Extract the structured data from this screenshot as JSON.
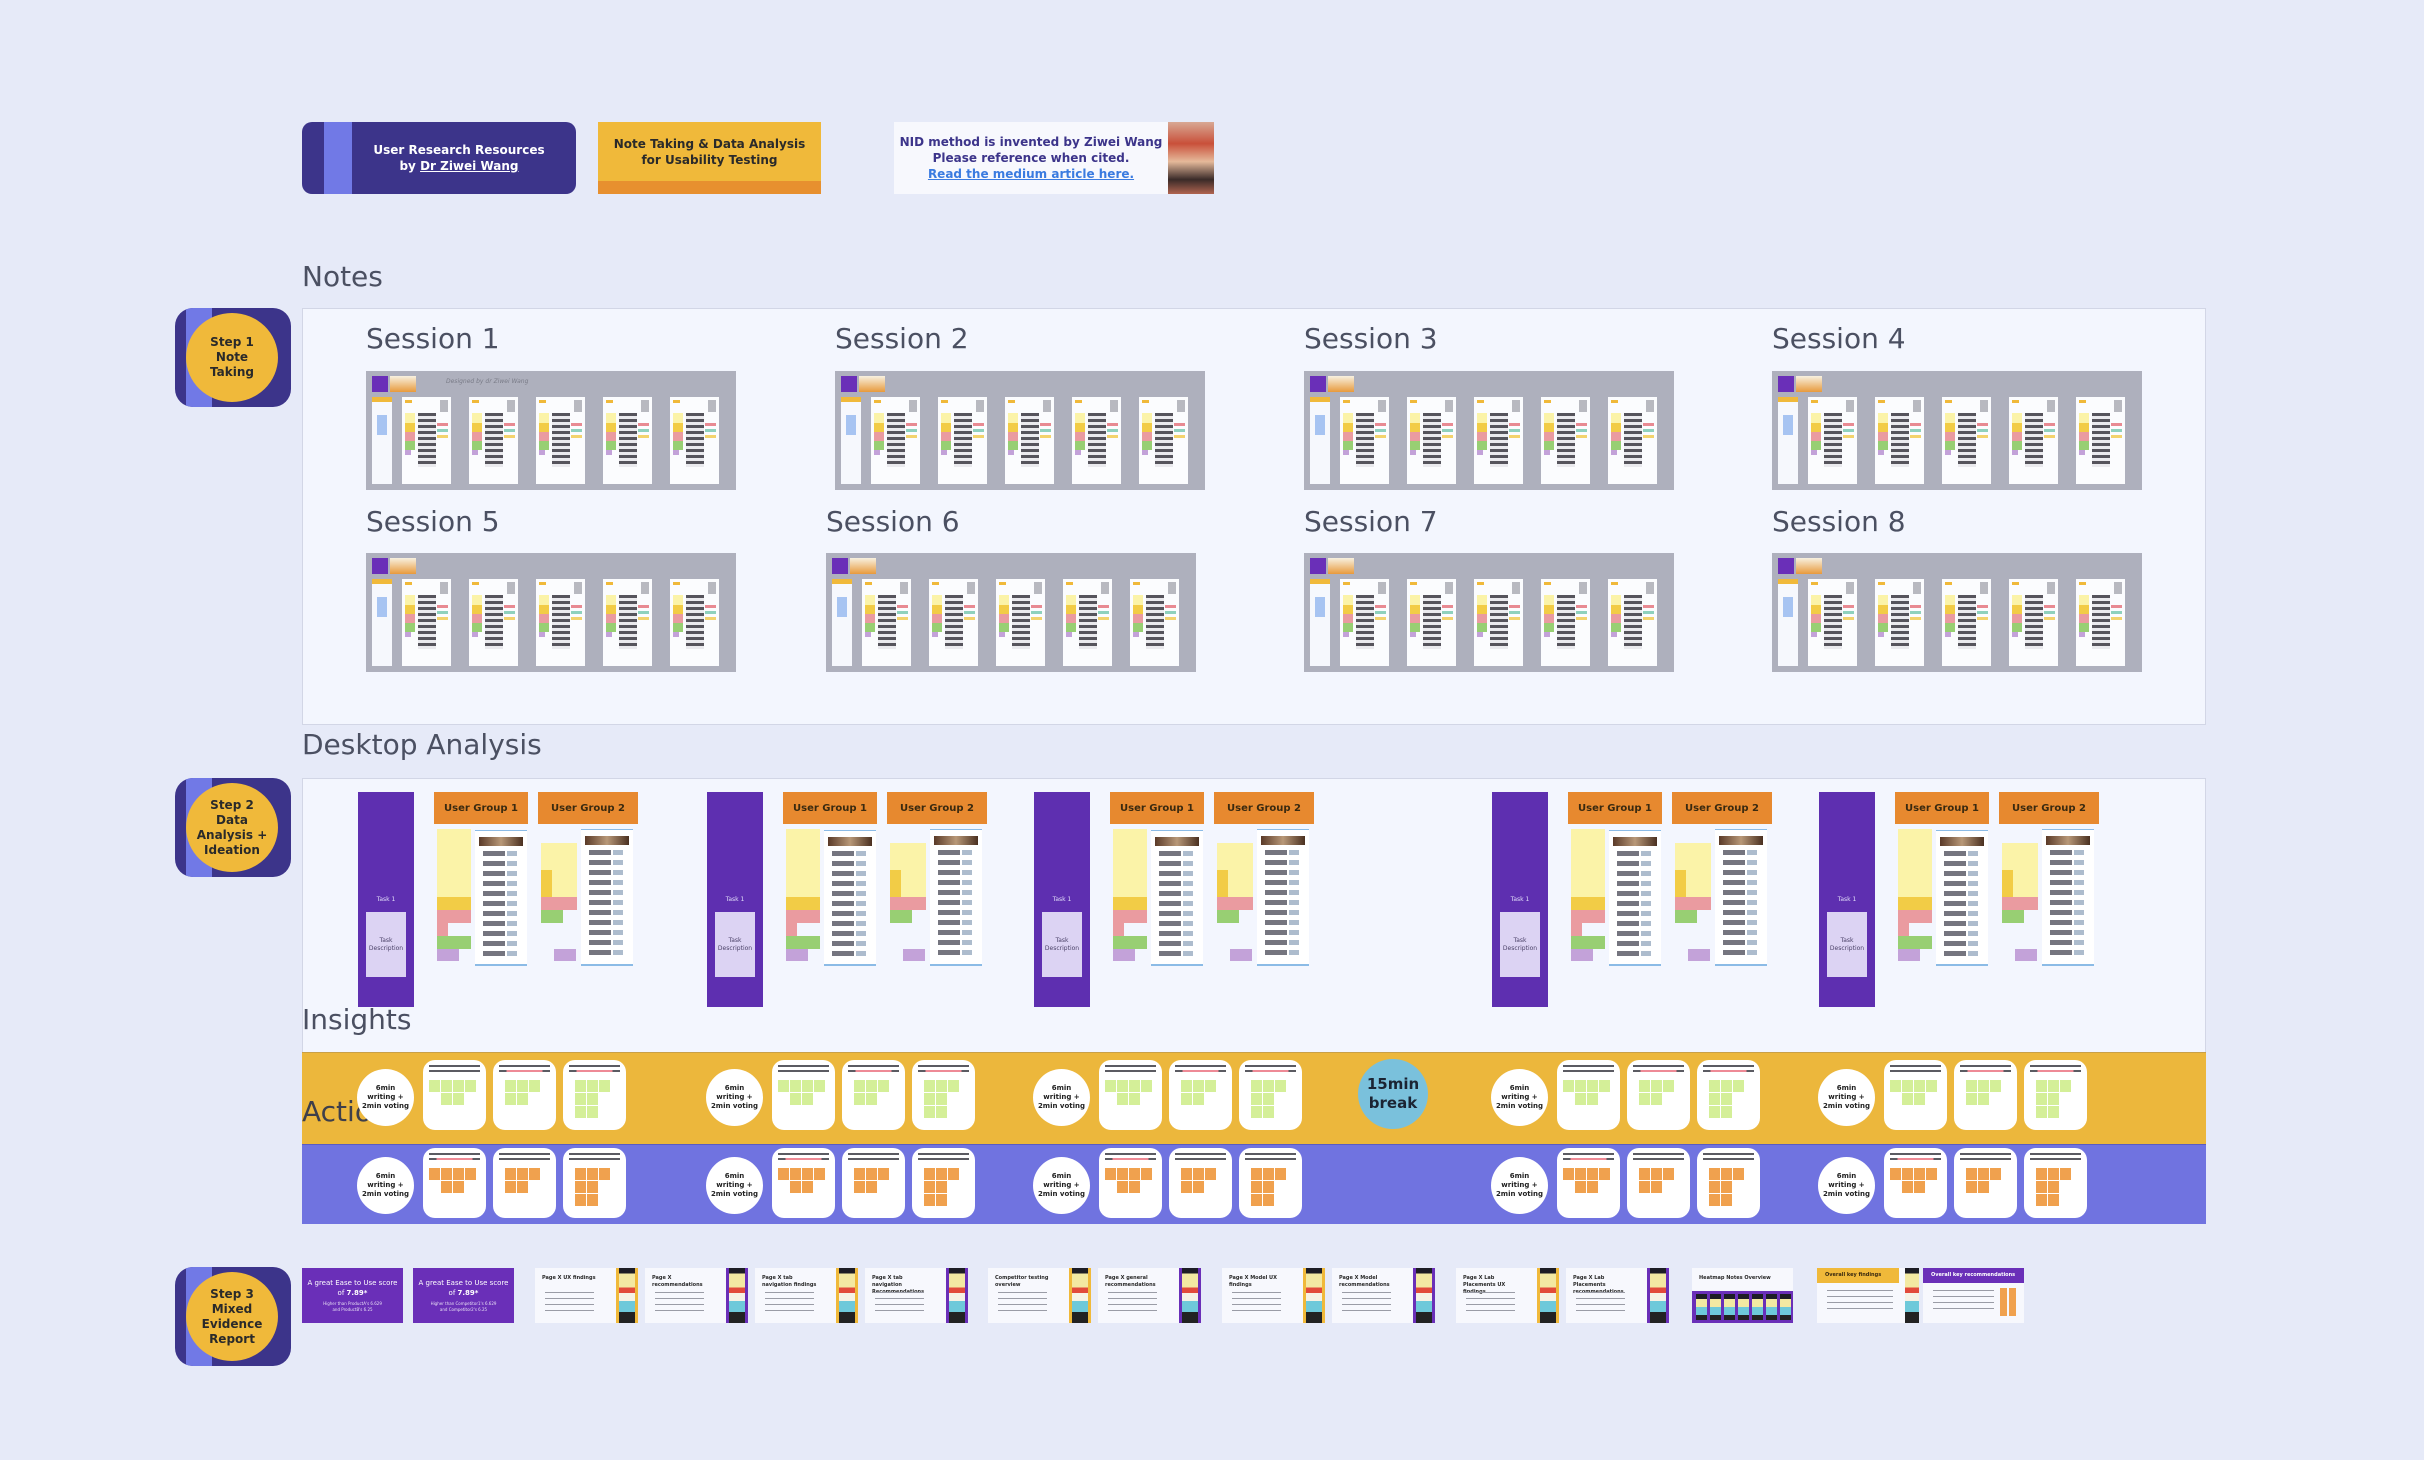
{
  "header": {
    "resources_button": {
      "line1": "User Research Resources",
      "line2_prefix": "by ",
      "author_link": "Dr Ziwei Wang"
    },
    "topic_button": {
      "line1": "Note Taking & Data Analysis",
      "line2": "for Usability Testing"
    },
    "citation_card": {
      "line1": "NID method is invented by Ziwei Wang",
      "line2": "Please reference when cited.",
      "link": "Read the medium article here."
    }
  },
  "colors": {
    "background": "#e6eaf8",
    "brand_indigo": "#3c348a",
    "accent_periwinkle": "#7179e6",
    "accent_yellow": "#f0b93a",
    "accent_orange": "#e7892f",
    "task_purple": "#5e2fb0",
    "break_blue": "#7ac1dc"
  },
  "steps": [
    {
      "label": "Step 1",
      "line2": "Note",
      "line3": "Taking",
      "line4": ""
    },
    {
      "label": "Step 2",
      "line2": "Data",
      "line3": "Analysis +",
      "line4": "Ideation"
    },
    {
      "label": "Step 3",
      "line2": "Mixed",
      "line3": "Evidence",
      "line4": "Report"
    }
  ],
  "notes": {
    "title": "Notes",
    "designed_by": "Designed by dr Ziwei Wang",
    "sessions": [
      "Session 1",
      "Session 2",
      "Session 3",
      "Session 4",
      "Session 5",
      "Session 6",
      "Session 7",
      "Session 8"
    ]
  },
  "desktop_analysis": {
    "title": "Desktop Analysis",
    "task_label": "Task 1",
    "task_description": "Task Description",
    "user_group_1": "User Group 1",
    "user_group_2": "User Group 2"
  },
  "insights": {
    "title": "Insights"
  },
  "actions": {
    "title": "Actions"
  },
  "timer": {
    "line1": "6min",
    "line2": "writing +",
    "line3": "2min voting"
  },
  "break": {
    "line1": "15min",
    "line2": "break"
  },
  "report": {
    "score_slides": [
      {
        "headline": "A great Ease to Use score",
        "score_prefix": "of ",
        "score": "7.89*",
        "sub1": "Higher than ProductA's 6.629",
        "sub2": "and ProductB's 6.25"
      },
      {
        "headline": "A great Ease to Use score",
        "score_prefix": "of ",
        "score": "7.89*",
        "sub1": "Higher than Competitor1's 6.629",
        "sub2": "and Competitor2's 6.25"
      }
    ],
    "slides": [
      {
        "title": "Page X UX findings",
        "phone": "y"
      },
      {
        "title": "Page X recommendations",
        "phone": "p"
      },
      {
        "title": "Page X tab navigation findings",
        "phone": "y"
      },
      {
        "title": "Page X tab navigation Recommendations",
        "phone": "p"
      },
      {
        "title": "Competitor testing overview",
        "phone": "y"
      },
      {
        "title": "Page X general recommendations",
        "phone": "p"
      },
      {
        "title": "Page X Model UX findings",
        "phone": "y"
      },
      {
        "title": "Page X Model recommendations",
        "phone": "p"
      },
      {
        "title": "Page X Lab Placements UX findings",
        "phone": "y"
      },
      {
        "title": "Page X Lab Placements recommendations",
        "phone": "p"
      }
    ],
    "heatmap_title": "Heatmap Notes Overview",
    "key_findings_title": "Overall key findings",
    "key_recommendations_title": "Overall key recommendations"
  }
}
